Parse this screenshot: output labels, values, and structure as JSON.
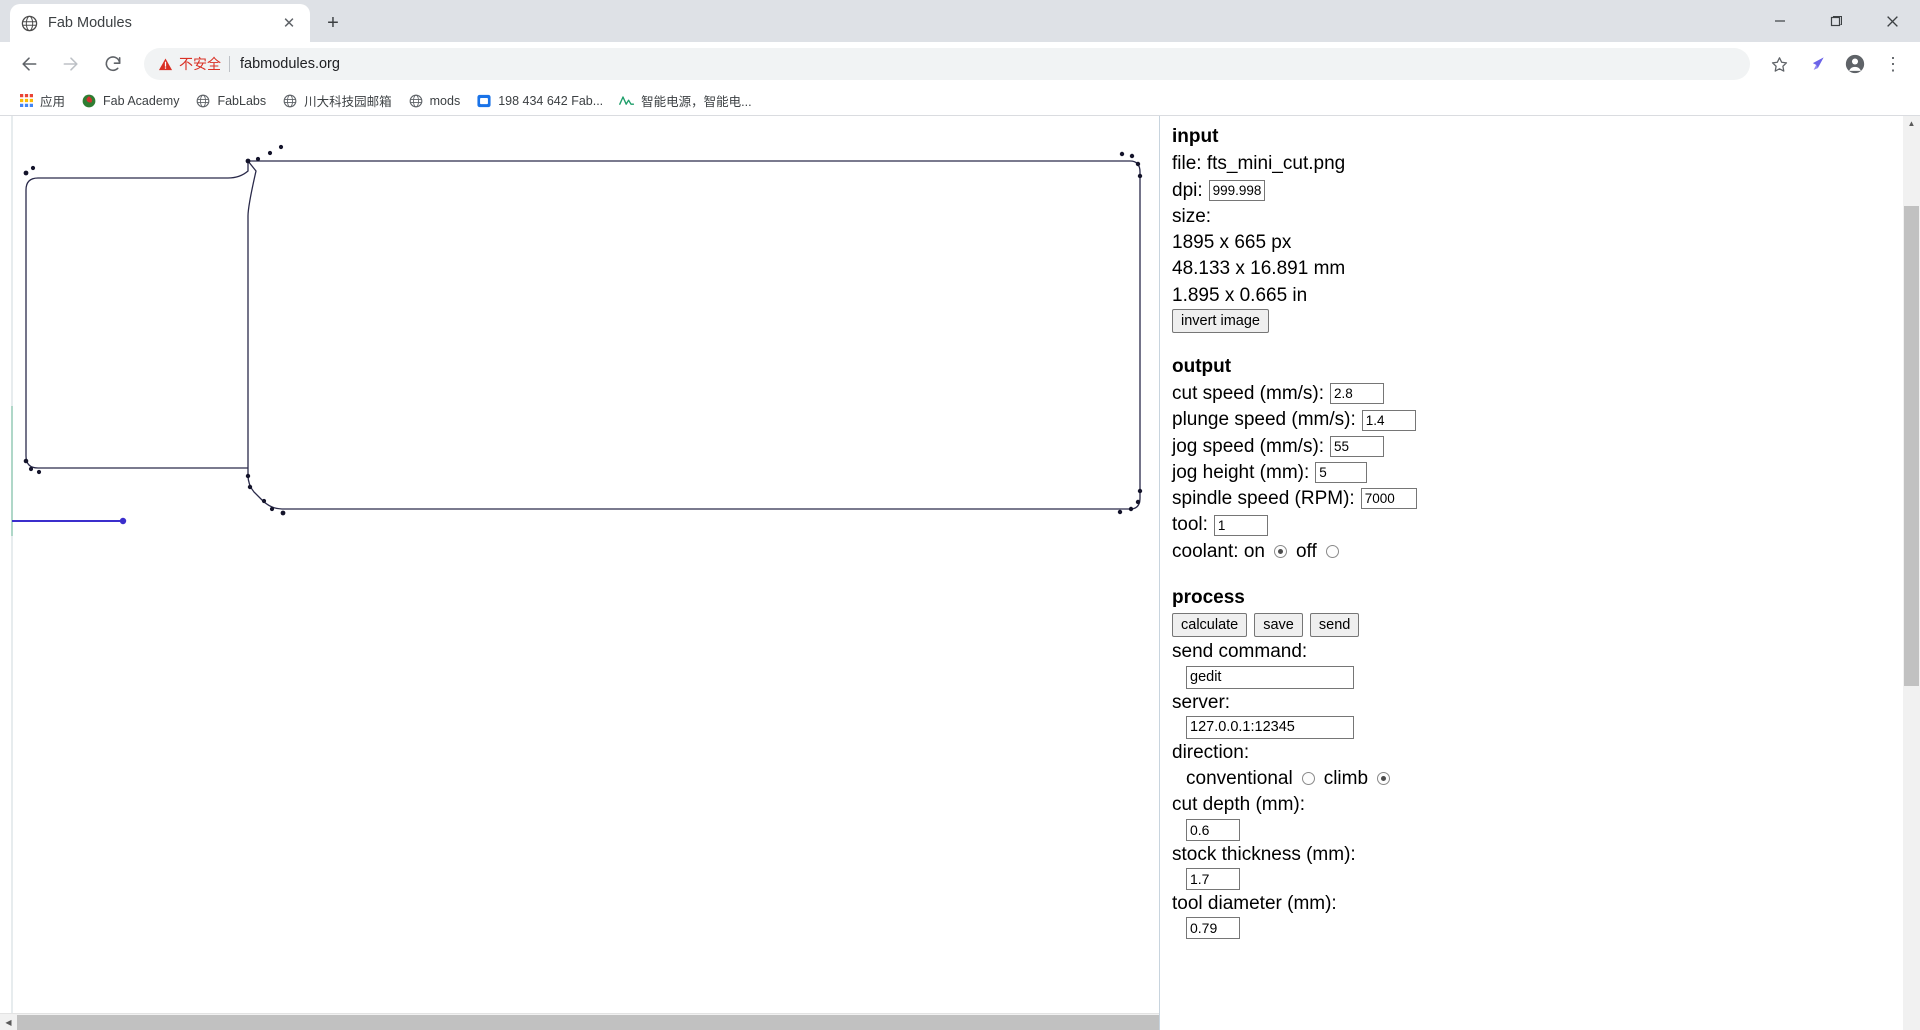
{
  "browser": {
    "tab": {
      "title": "Fab Modules",
      "favicon": "globe-icon",
      "close": "✕"
    },
    "new_tab": "+",
    "window_controls": {
      "minimize": "—",
      "maximize": "❐",
      "close": "✕"
    },
    "nav": {
      "back": "←",
      "forward": "→",
      "reload": "⟳"
    },
    "omnibox": {
      "warning_label": "不安全",
      "url": "fabmodules.org",
      "star": "☆",
      "extension": "extension-icon",
      "profile": "profile-icon",
      "menu": "⋮"
    },
    "bookmarks": [
      {
        "label": "应用",
        "icon": "apps-grid-icon"
      },
      {
        "label": "Fab Academy",
        "icon": "fab-academy-icon"
      },
      {
        "label": "FabLabs",
        "icon": "globe-icon"
      },
      {
        "label": "川大科技园邮箱",
        "icon": "globe-icon"
      },
      {
        "label": "mods",
        "icon": "globe-icon"
      },
      {
        "label": "198 434 642 Fab...",
        "icon": "chat-icon"
      },
      {
        "label": "智能电源，智能电...",
        "icon": "waveform-icon"
      }
    ]
  },
  "panel": {
    "input": {
      "heading": "input",
      "file_label": "file: fts_mini_cut.png",
      "dpi_label": "dpi:",
      "dpi_value": "999.998",
      "size_label": "size:",
      "size_px": "1895 x 665 px",
      "size_mm": "48.133 x 16.891 mm",
      "size_in": "1.895 x 0.665 in",
      "invert_button": "invert image"
    },
    "output": {
      "heading": "output",
      "cut_speed_label": "cut speed (mm/s):",
      "cut_speed_value": "2.8",
      "plunge_speed_label": "plunge speed (mm/s):",
      "plunge_speed_value": "1.4",
      "jog_speed_label": "jog speed (mm/s):",
      "jog_speed_value": "55",
      "jog_height_label": "jog height (mm):",
      "jog_height_value": "5",
      "spindle_speed_label": "spindle speed (RPM):",
      "spindle_speed_value": "7000",
      "tool_label": "tool:",
      "tool_value": "1",
      "coolant_label": "coolant: on",
      "coolant_off_label": "off",
      "coolant_selected": "on"
    },
    "process": {
      "heading": "process",
      "calculate_button": "calculate",
      "save_button": "save",
      "send_button": "send",
      "send_command_label": "send command:",
      "send_command_value": "gedit",
      "server_label": "server:",
      "server_value": "127.0.0.1:12345",
      "direction_label": "direction:",
      "conventional_label": "conventional",
      "climb_label": "climb",
      "direction_selected": "climb",
      "cut_depth_label": "cut depth (mm):",
      "cut_depth_value": "0.6",
      "stock_thickness_label": "stock thickness (mm):",
      "stock_thickness_value": "1.7",
      "tool_diameter_label": "tool diameter (mm):",
      "tool_diameter_value": "0.79"
    }
  },
  "canvas": {
    "name": "toolpath-preview",
    "path_color": "#2a2a4a",
    "origin_color": "#3b2ecc",
    "axis_color": "#8fd6b4"
  }
}
